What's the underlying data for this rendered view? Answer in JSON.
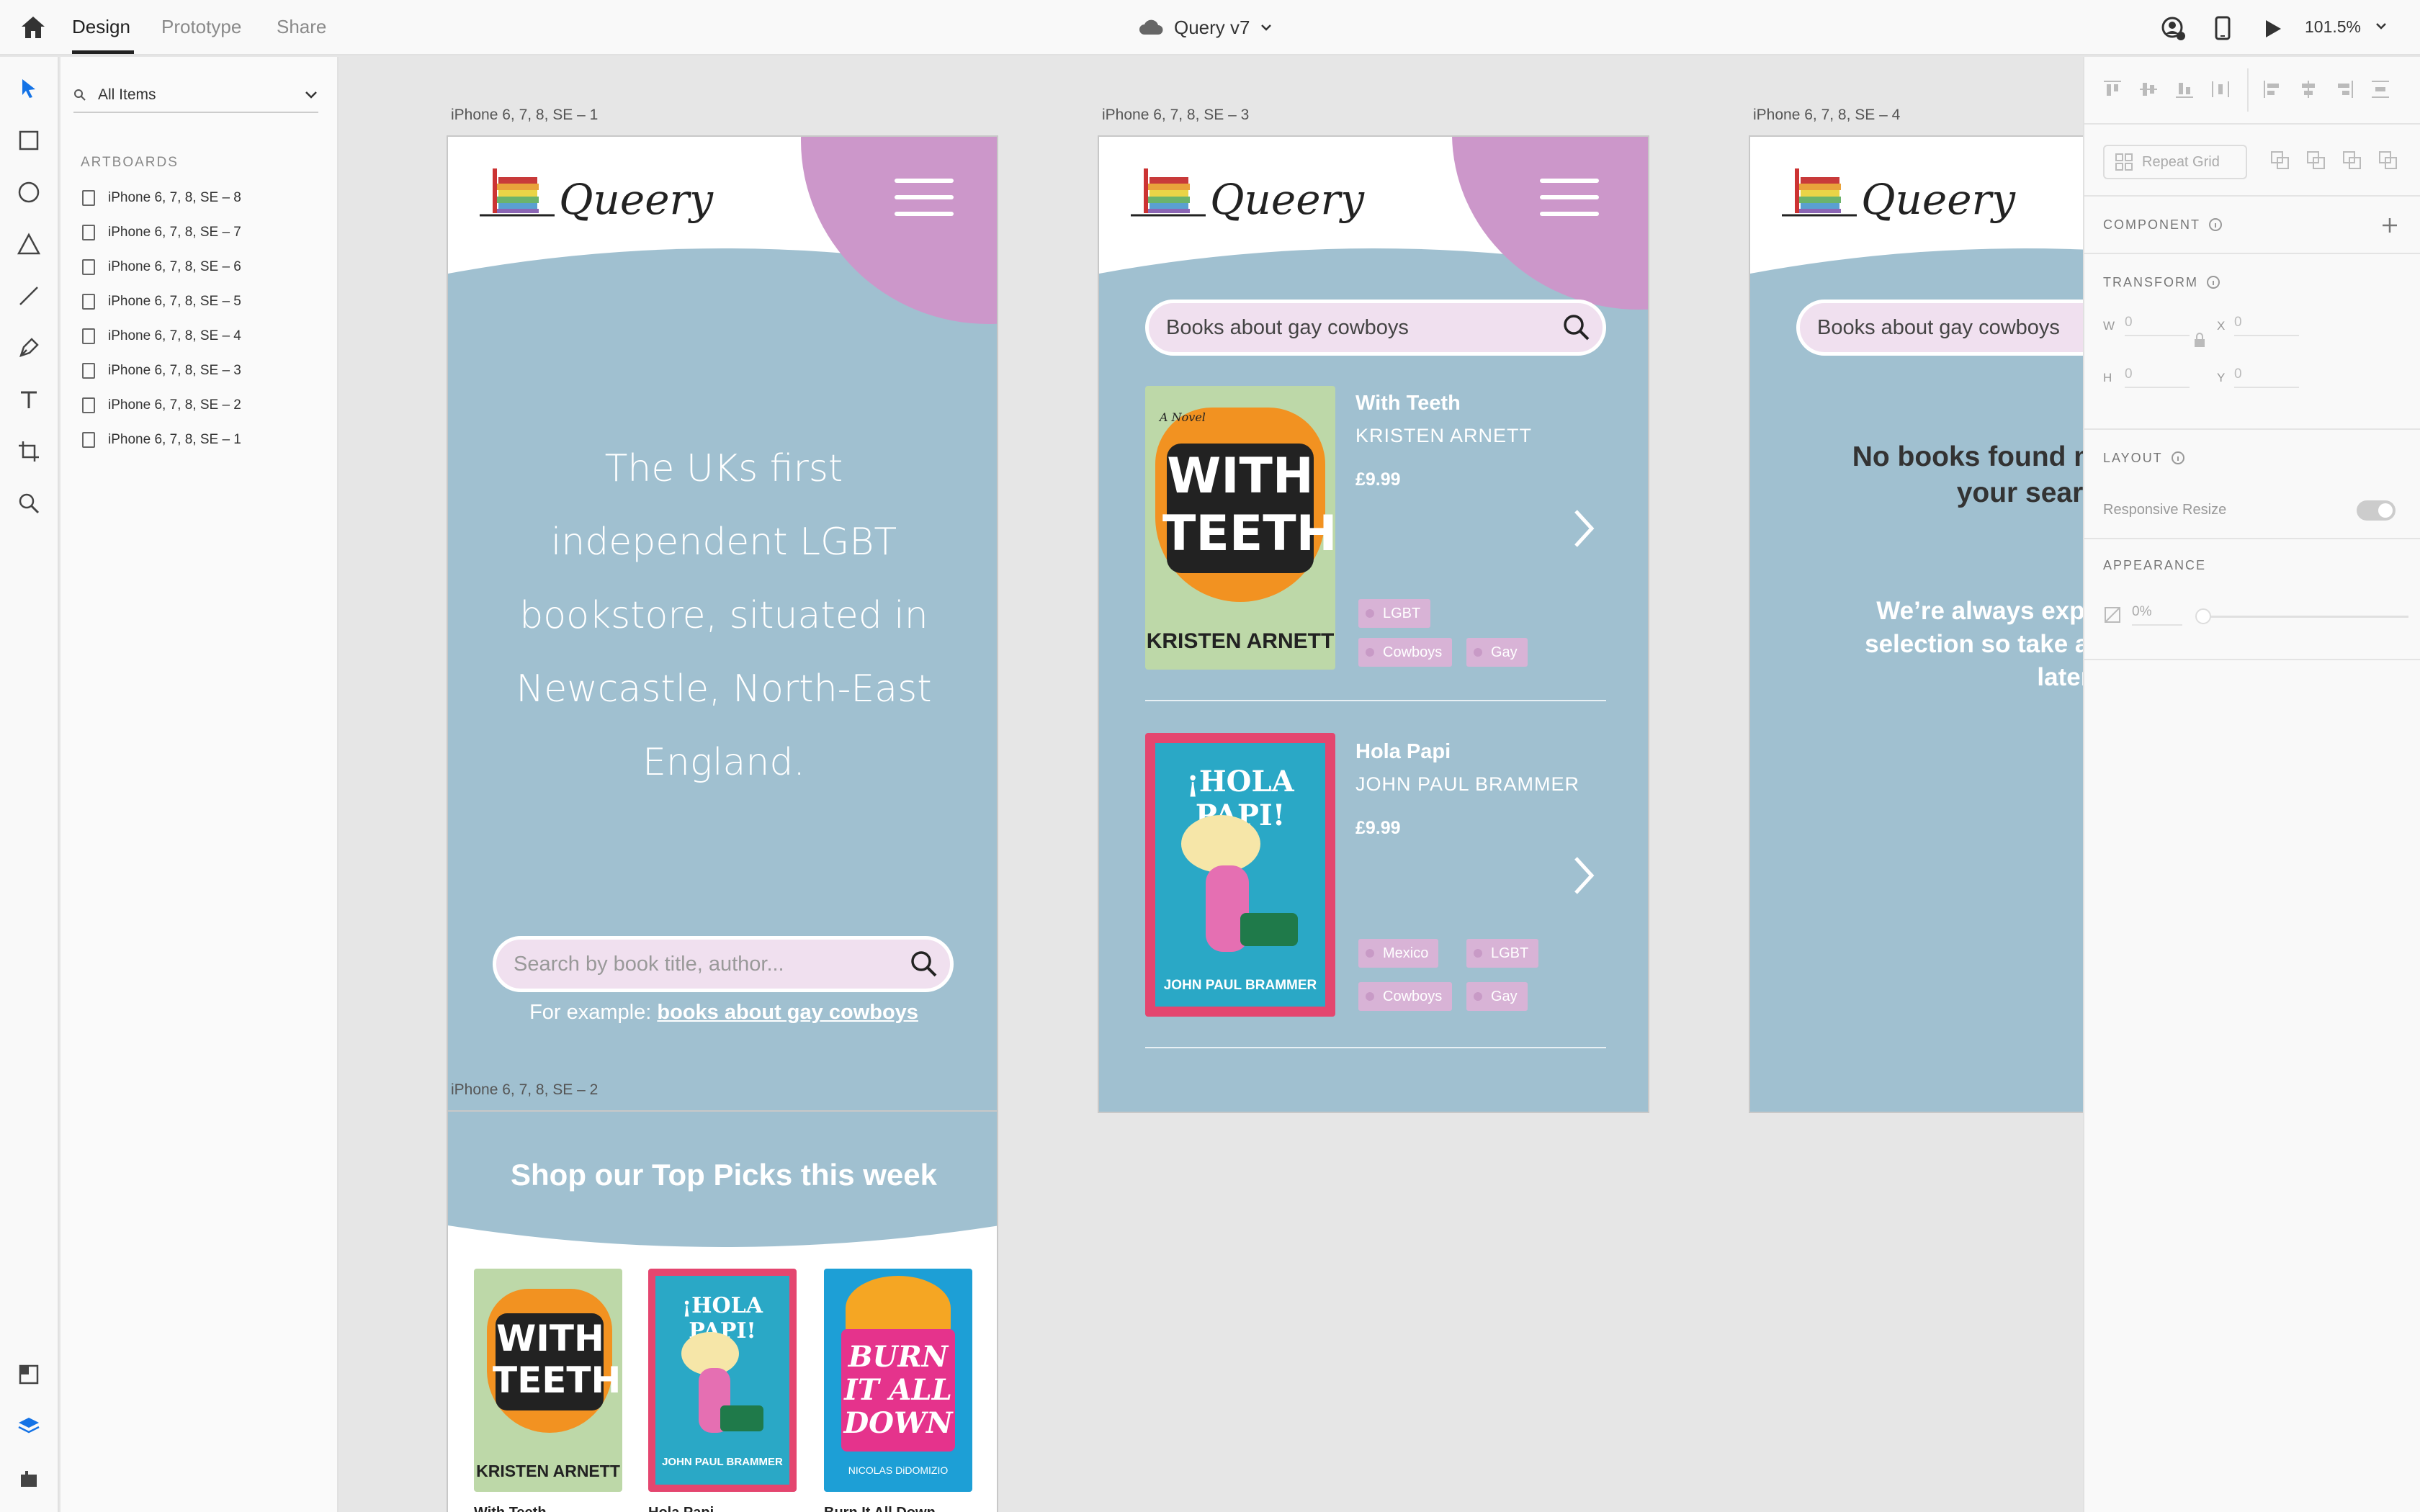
{
  "topbar": {
    "tabs": [
      "Design",
      "Prototype",
      "Share"
    ],
    "doc_title": "Query v7",
    "zoom": "101.5%"
  },
  "layers": {
    "filter": "All Items",
    "section": "ARTBOARDS",
    "items": [
      "iPhone 6, 7, 8, SE – 8",
      "iPhone 6, 7, 8, SE – 7",
      "iPhone 6, 7, 8, SE – 6",
      "iPhone 6, 7, 8, SE – 5",
      "iPhone 6, 7, 8, SE – 4",
      "iPhone 6, 7, 8, SE – 3",
      "iPhone 6, 7, 8, SE – 2",
      "iPhone 6, 7, 8, SE – 1"
    ]
  },
  "inspector": {
    "repeat_grid": "Repeat Grid",
    "component": "COMPONENT",
    "transform": "TRANSFORM",
    "w_label": "W",
    "w": "0",
    "x_label": "X",
    "x": "0",
    "h_label": "H",
    "h": "0",
    "y_label": "Y",
    "y": "0",
    "layout": "LAYOUT",
    "responsive": "Responsive Resize",
    "appearance": "APPEARANCE",
    "opacity": "0%"
  },
  "artboards": {
    "a1": {
      "label": "iPhone 6, 7, 8, SE – 1",
      "logo": "Queery",
      "tagline": [
        "The UKs first",
        "independent LGBT",
        "bookstore, situated in",
        "Newcastle, North-East",
        "England."
      ],
      "search_placeholder": "Search by book title, author...",
      "example_prefix": "For example: ",
      "example_link": "books about gay cowboys"
    },
    "a2": {
      "label": "iPhone 6, 7, 8, SE – 2",
      "heading": "Shop our Top Picks this week",
      "picks": [
        "With Teeth",
        "Hola Papi",
        "Burn It All Down"
      ]
    },
    "a3": {
      "label": "iPhone 6, 7, 8, SE – 3",
      "logo": "Queery",
      "search_value": "Books about gay cowboys",
      "results": [
        {
          "title": "With Teeth",
          "author": "KRISTEN ARNETT",
          "price": "£9.99",
          "tags": [
            "LGBT",
            "Cowboys",
            "Gay"
          ]
        },
        {
          "title": "Hola Papi",
          "author": "JOHN PAUL BRAMMER",
          "price": "£9.99",
          "tags": [
            "Mexico",
            "LGBT",
            "Cowboys",
            "Gay"
          ]
        }
      ]
    },
    "a4": {
      "label": "iPhone 6, 7, 8, SE – 4",
      "logo": "Queery",
      "search_value": "Books about gay cowboys",
      "no_results": [
        "No books found m",
        "your searc"
      ],
      "expanding": [
        "We’re always expa",
        "selection so take ar",
        "later!"
      ]
    }
  },
  "covers": {
    "with_teeth": {
      "small": "A Novel",
      "line1": "WITH",
      "line2": "TEETH",
      "author": "KRISTEN ARNETT"
    },
    "hola_papi": {
      "title": "¡HOLA PAPI!",
      "author": "JOHN PAUL BRAMMER"
    },
    "burn": {
      "line1": "BURN",
      "line2": "IT ALL",
      "line3": "DOWN",
      "author": "NICOLAS DiDOMIZIO"
    }
  },
  "colors": {
    "accent": "#cc97ca",
    "mobile_bg": "#a0c0d0",
    "search_bg": "#f0e0ef"
  }
}
